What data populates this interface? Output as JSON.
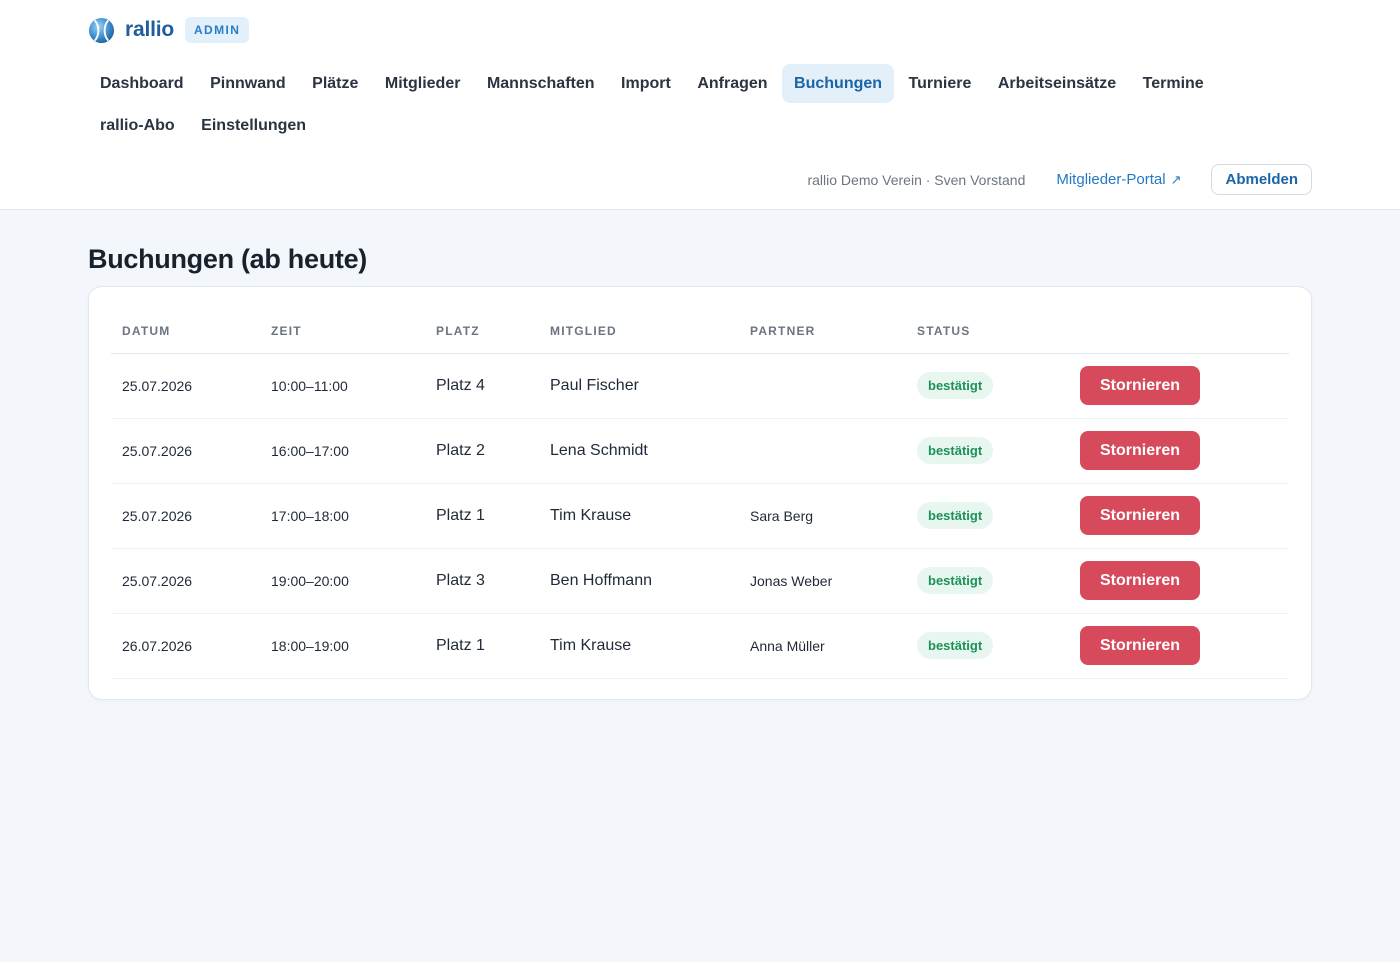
{
  "brand": {
    "name": "rallio",
    "badge": "ADMIN",
    "logo_icon": "tennis-ball-icon",
    "color": "#1f5e99"
  },
  "nav": {
    "active": "Buchungen",
    "items": [
      "Dashboard",
      "Pinnwand",
      "Plätze",
      "Mitglieder",
      "Mannschaften",
      "Import",
      "Anfragen",
      "Buchungen",
      "Turniere",
      "Arbeitseinsätze",
      "Termine",
      "rallio-Abo",
      "Einstellungen"
    ]
  },
  "user": {
    "info": "rallio Demo Verein · Sven Vorstand",
    "portal_link": "Mitglieder-Portal",
    "portal_icon": "arrow-up-right-icon",
    "logout": "Abmelden"
  },
  "page": {
    "title": "Buchungen (ab heute)"
  },
  "table": {
    "headers": [
      "DATUM",
      "ZEIT",
      "PLATZ",
      "MITGLIED",
      "PARTNER",
      "STATUS",
      ""
    ],
    "rows": [
      {
        "datum": "25.07.2026",
        "zeit": "10:00–11:00",
        "platz": "Platz 4",
        "mitglied": "Paul Fischer",
        "partner": "",
        "status": "bestätigt",
        "action": "Stornieren"
      },
      {
        "datum": "25.07.2026",
        "zeit": "16:00–17:00",
        "platz": "Platz 2",
        "mitglied": "Lena Schmidt",
        "partner": "",
        "status": "bestätigt",
        "action": "Stornieren"
      },
      {
        "datum": "25.07.2026",
        "zeit": "17:00–18:00",
        "platz": "Platz 1",
        "mitglied": "Tim Krause",
        "partner": "Sara Berg",
        "status": "bestätigt",
        "action": "Stornieren"
      },
      {
        "datum": "25.07.2026",
        "zeit": "19:00–20:00",
        "platz": "Platz 3",
        "mitglied": "Ben Hoffmann",
        "partner": "Jonas Weber",
        "status": "bestätigt",
        "action": "Stornieren"
      },
      {
        "datum": "26.07.2026",
        "zeit": "18:00–19:00",
        "platz": "Platz 1",
        "mitglied": "Tim Krause",
        "partner": "Anna Müller",
        "status": "bestätigt",
        "action": "Stornieren"
      }
    ]
  },
  "colors": {
    "accent": "#1b64a8",
    "danger": "#d64a5c",
    "success": "#1d9158",
    "background": "#f3f7fb"
  }
}
